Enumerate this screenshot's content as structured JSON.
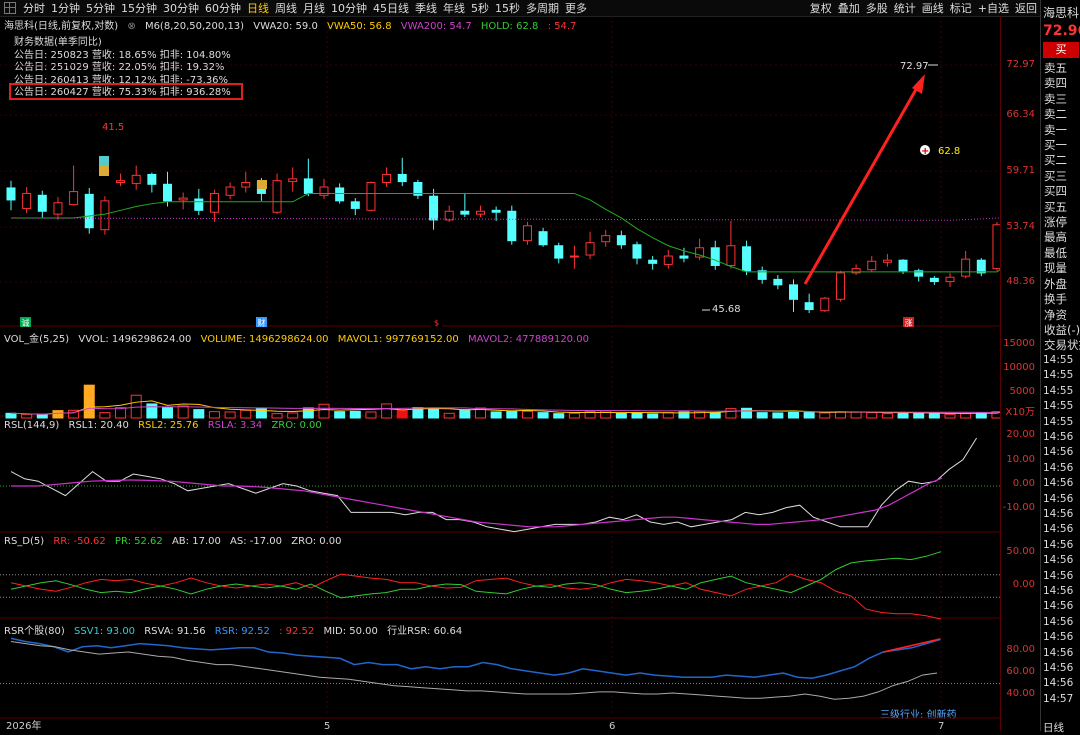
{
  "toolbar": {
    "periods": [
      "分时",
      "1分钟",
      "5分钟",
      "15分钟",
      "30分钟",
      "60分钟",
      "日线",
      "周线",
      "月线",
      "10分钟",
      "45日线",
      "季线",
      "年线",
      "5秒",
      "15秒",
      "多周期",
      "更多"
    ],
    "active": "日线",
    "right": [
      "复权",
      "叠加",
      "多股",
      "统计",
      "画线",
      "标记",
      "+自选",
      "返回"
    ]
  },
  "stock": {
    "name": "海思科",
    "price": "72.96",
    "buy_label": "买",
    "header_title": "海思科(日线,前复权,对数)",
    "ma_label": "M6(8,20,50,200,13)",
    "vwa20": "VWA20: 59.0",
    "vwa50": "VWA50: 56.8",
    "vwa200": "VWA200: 54.7",
    "hold": "HOLD: 62.8",
    "hold_val": ": 54.7"
  },
  "finance": {
    "title": "财务数据(单季同比)",
    "rows": [
      "公告日: 250823  营收: 18.65%   扣非: 104.80%",
      "公告日: 251029  营收: 22.05%   扣非: 19.32%",
      "公告日: 260413  营收: 12.12%   扣非: -73.36%",
      "公告日: 260427  营收: 75.33%   扣非: 936.28%"
    ]
  },
  "annotations": {
    "high": "72.97",
    "low": "45.68",
    "peak_left": "41.5",
    "hold_mark": "62.8",
    "mark_a": "诚",
    "mark_b": "财",
    "mark_c": "$",
    "mark_d": "涨"
  },
  "price_axis": [
    "72.97",
    "66.34",
    "59.71",
    "53.74",
    "48.36"
  ],
  "vol": {
    "header": [
      "VOL_金(5,25)",
      "VVOL: 1496298624.00",
      "VOLUME: 1496298624.00",
      "MAVOL1: 997769152.00",
      "MAVOL2: 477889120.00"
    ],
    "axis": [
      "15000",
      "10000",
      "5000",
      "X10万"
    ]
  },
  "rsl": {
    "header": [
      "RSL(144,9)",
      "RSL1: 20.40",
      "RSL2: 25.76",
      "RSLA: 3.34",
      "ZRO: 0.00"
    ],
    "axis": [
      "20.00",
      "10.00",
      "0.00",
      "-10.00"
    ]
  },
  "rsd": {
    "header": [
      "RS_D(5)",
      "RR: -50.62",
      "PR: 52.62",
      "AB: 17.00",
      "AS: -17.00",
      "ZRO: 0.00"
    ],
    "axis": [
      "50.00",
      "0.00"
    ]
  },
  "rsr": {
    "header": [
      "RSR个股(80)",
      "SSV1: 93.00",
      "RSVA: 91.56",
      "RSR: 92.52",
      ": 92.52",
      "MID: 50.00",
      "行业RSR: 60.64"
    ],
    "axis": [
      "80.00",
      "60.00",
      "40.00"
    ],
    "industry": "三级行业: 创新药"
  },
  "xaxis": [
    "2026年",
    "5",
    "6",
    "7"
  ],
  "right_panel": {
    "order": [
      "卖五",
      "卖四",
      "卖三",
      "卖二",
      "卖一",
      "买一",
      "买二",
      "买三",
      "买四",
      "买五",
      "涨停",
      "最高",
      "最低",
      "现量",
      "外盘",
      "换手",
      "净资",
      "收益(-)",
      "交易状态"
    ],
    "times": [
      "14:55",
      "14:55",
      "14:55",
      "14:55",
      "14:55",
      "14:56",
      "14:56",
      "14:56",
      "14:56",
      "14:56",
      "14:56",
      "14:56",
      "14:56",
      "14:56",
      "14:56",
      "14:56",
      "14:56",
      "14:56",
      "14:56",
      "14:56",
      "14:56",
      "14:56",
      "14:57"
    ],
    "bottom": "日线"
  },
  "colors": {
    "up": "#ff3333",
    "down": "#55ffff",
    "bg": "#000000"
  }
}
